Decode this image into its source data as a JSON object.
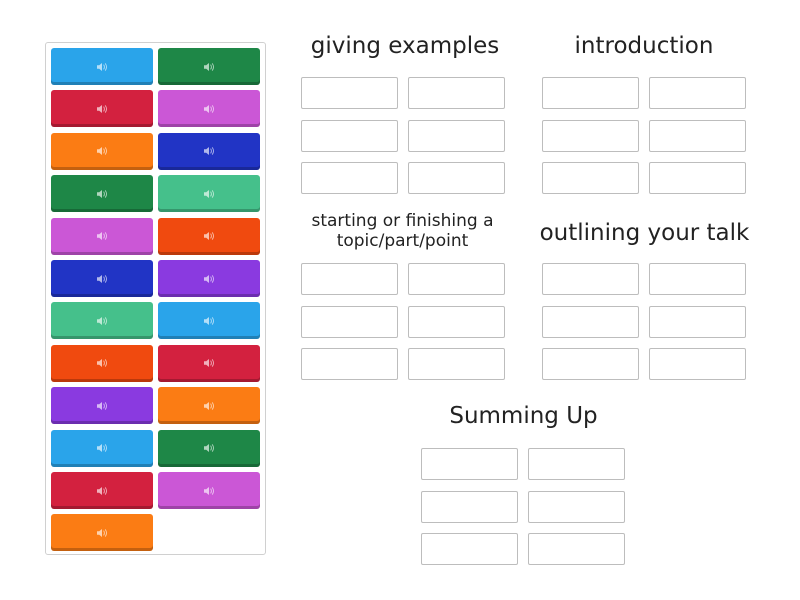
{
  "tiles": [
    {
      "color": "#2aa4ea",
      "icon": "speaker-icon"
    },
    {
      "color": "#1e8747",
      "icon": "speaker-icon"
    },
    {
      "color": "#d3213f",
      "icon": "speaker-icon"
    },
    {
      "color": "#cb57d6",
      "icon": "speaker-icon"
    },
    {
      "color": "#fb7c14",
      "icon": "speaker-icon"
    },
    {
      "color": "#2134c5",
      "icon": "speaker-icon"
    },
    {
      "color": "#1e8747",
      "icon": "speaker-icon"
    },
    {
      "color": "#45c08b",
      "icon": "speaker-icon"
    },
    {
      "color": "#cb57d6",
      "icon": "speaker-icon"
    },
    {
      "color": "#f04a0f",
      "icon": "speaker-icon"
    },
    {
      "color": "#2134c5",
      "icon": "speaker-icon"
    },
    {
      "color": "#8a3ae0",
      "icon": "speaker-icon"
    },
    {
      "color": "#45c08b",
      "icon": "speaker-icon"
    },
    {
      "color": "#2aa4ea",
      "icon": "speaker-icon"
    },
    {
      "color": "#f04a0f",
      "icon": "speaker-icon"
    },
    {
      "color": "#d3213f",
      "icon": "speaker-icon"
    },
    {
      "color": "#8a3ae0",
      "icon": "speaker-icon"
    },
    {
      "color": "#fb7c14",
      "icon": "speaker-icon"
    },
    {
      "color": "#2aa4ea",
      "icon": "speaker-icon"
    },
    {
      "color": "#1e8747",
      "icon": "speaker-icon"
    },
    {
      "color": "#d3213f",
      "icon": "speaker-icon"
    },
    {
      "color": "#cb57d6",
      "icon": "speaker-icon"
    },
    {
      "color": "#fb7c14",
      "icon": "speaker-icon"
    }
  ],
  "groups": [
    {
      "title": "giving examples"
    },
    {
      "title": "introduction"
    },
    {
      "title": "starting or finishing a topic/part/point"
    },
    {
      "title": "outlining your talk"
    },
    {
      "title": "Summing Up"
    }
  ]
}
